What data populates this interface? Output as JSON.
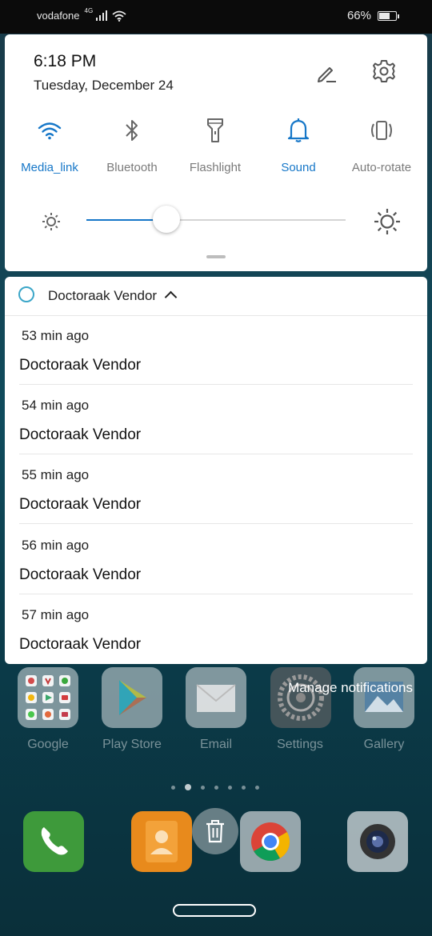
{
  "status_bar": {
    "carrier": "vodafone",
    "network": "4G",
    "battery": "66%",
    "battery_level": 0.66
  },
  "quick_settings": {
    "time": "6:18 PM",
    "date": "Tuesday, December 24",
    "tiles": [
      {
        "label": "Media_link",
        "icon": "wifi-icon",
        "active": true
      },
      {
        "label": "Bluetooth",
        "icon": "bluetooth-icon",
        "active": false
      },
      {
        "label": "Flashlight",
        "icon": "flashlight-icon",
        "active": false
      },
      {
        "label": "Sound",
        "icon": "bell-icon",
        "active": true
      },
      {
        "label": "Auto-rotate",
        "icon": "auto-rotate-icon",
        "active": false
      }
    ],
    "brightness_level": 0.31,
    "accent_color": "#1677c8"
  },
  "notification_group": {
    "app_name": "Doctoraak Vendor",
    "items": [
      {
        "time": "53 min ago",
        "title": "Doctoraak Vendor"
      },
      {
        "time": "54 min ago",
        "title": "Doctoraak Vendor"
      },
      {
        "time": "55 min ago",
        "title": "Doctoraak Vendor"
      },
      {
        "time": "56 min ago",
        "title": "Doctoraak Vendor"
      },
      {
        "time": "57 min ago",
        "title": "Doctoraak Vendor"
      }
    ]
  },
  "manage_notifications": "Manage notifications",
  "home_apps": [
    {
      "label": "Google",
      "icon": "google-folder-icon"
    },
    {
      "label": "Play Store",
      "icon": "play-store-icon"
    },
    {
      "label": "Email",
      "icon": "email-icon"
    },
    {
      "label": "Settings",
      "icon": "settings-icon"
    },
    {
      "label": "Gallery",
      "icon": "gallery-icon"
    }
  ],
  "page_indicator": {
    "count": 7,
    "active": 1
  },
  "dock": [
    {
      "icon": "phone-icon"
    },
    {
      "icon": "contacts-icon"
    },
    {
      "icon": "chrome-icon"
    },
    {
      "icon": "camera-icon"
    }
  ]
}
